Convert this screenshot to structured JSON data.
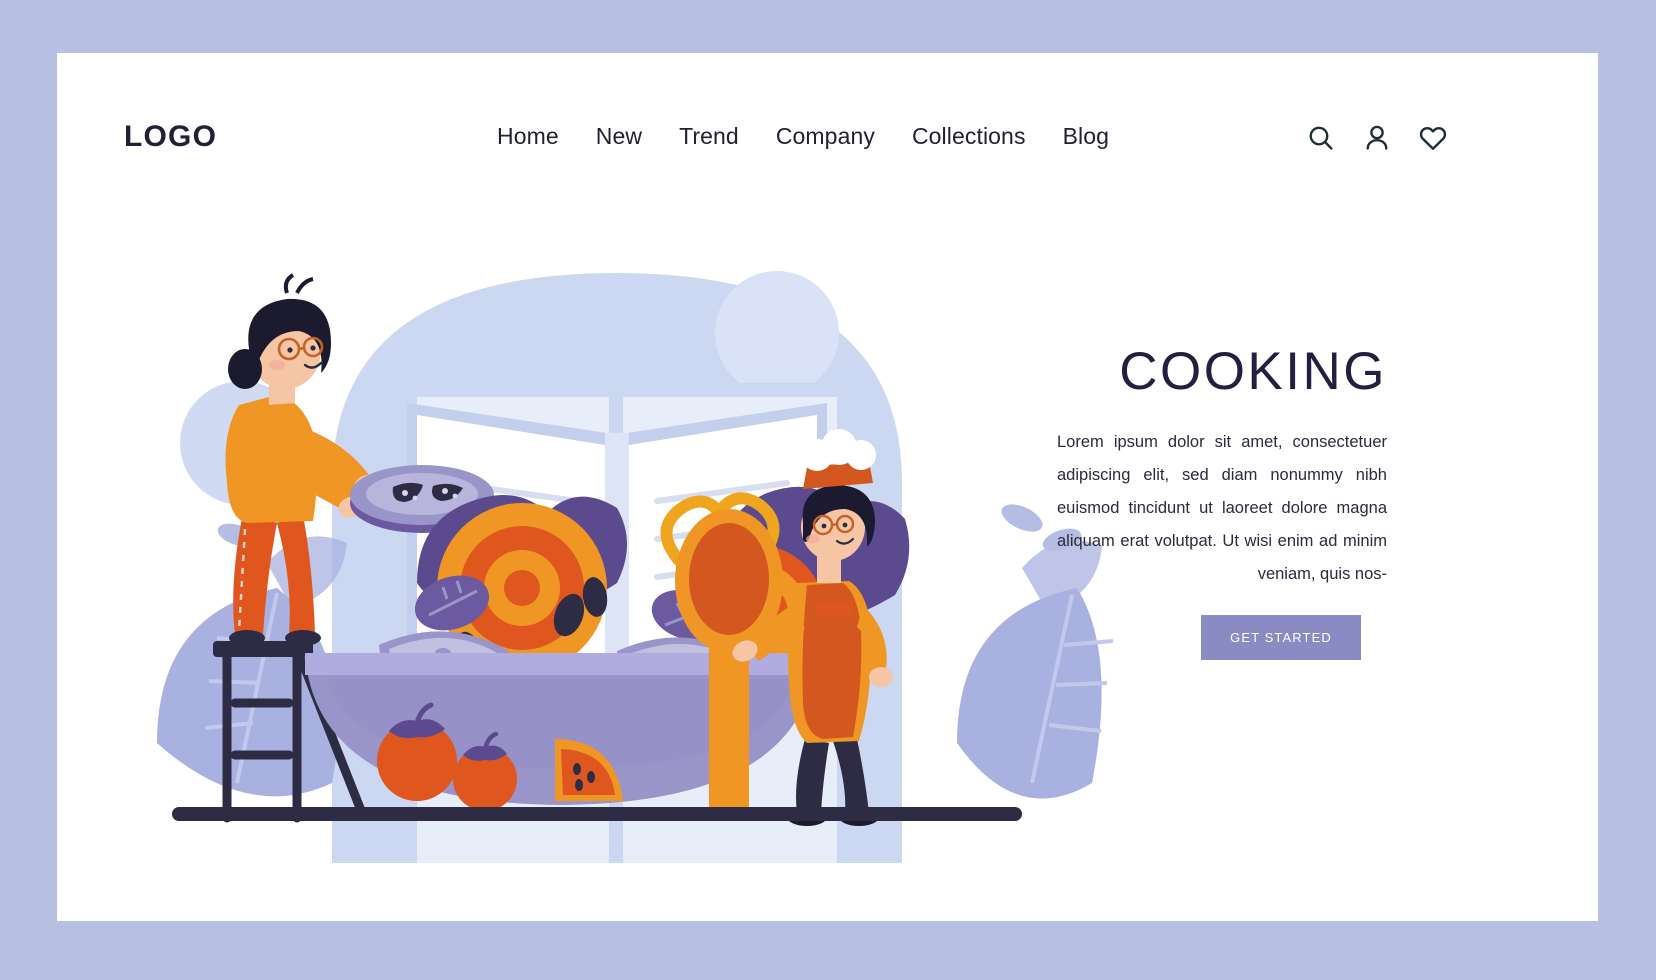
{
  "brand": {
    "logo": "LOGO"
  },
  "nav": {
    "items": [
      {
        "label": "Home"
      },
      {
        "label": "New"
      },
      {
        "label": "Trend"
      },
      {
        "label": "Company"
      },
      {
        "label": "Collections"
      },
      {
        "label": "Blog"
      }
    ]
  },
  "header_icons": [
    {
      "name": "search-icon"
    },
    {
      "name": "user-icon"
    },
    {
      "name": "heart-icon"
    }
  ],
  "hero": {
    "headline": "COOKING",
    "paragraph": "Lorem ipsum dolor sit amet, consectetuer adipiscing elit, sed diam nonummy nibh euismod tincidunt ut laoreet dolore magna aliquam erat volutpat. Ut wisi enim ad minim veniam, quis nos-",
    "cta_label": "GET STARTED"
  },
  "illustration": {
    "alt": "Two cooks preparing a giant bowl of vegetables in front of an open cookbook",
    "elements": [
      "woman-on-stepladder-with-plate",
      "giant-salad-bowl",
      "open-cookbook-background",
      "wooden-spoon",
      "chef-boy-with-hat",
      "tomatoes",
      "melon-slice",
      "leaf-decorations"
    ]
  },
  "colors": {
    "page_background": "#b7c0e2",
    "panel_background": "#ffffff",
    "text_dark": "#232036",
    "headline": "#241f41",
    "cta_background": "#8b8bc4",
    "cta_text": "#ffffff",
    "illus_blue_light": "#e3e8f7",
    "illus_blue_mid": "#c6d2ee",
    "illus_periwinkle": "#a7aede",
    "illus_purple": "#5b4a8e",
    "illus_purple_light": "#9a95c9",
    "illus_orange": "#f0941f",
    "illus_orange_dark": "#e0561f",
    "illus_navy": "#2e2b45"
  }
}
